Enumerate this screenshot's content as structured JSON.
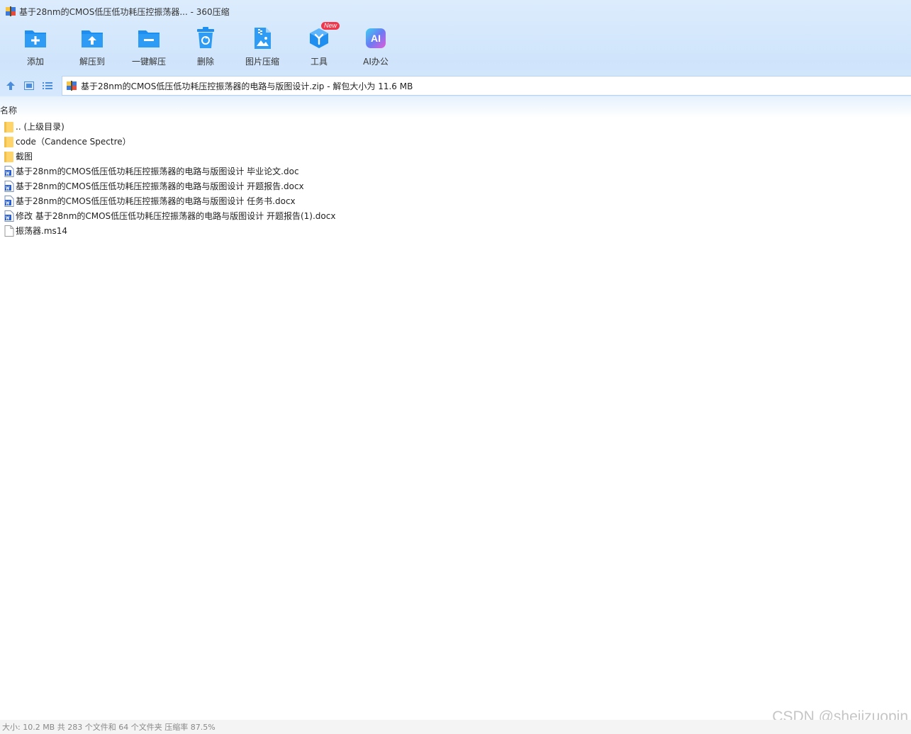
{
  "window": {
    "title": "基于28nm的CMOS低压低功耗压控振荡器... - 360压缩"
  },
  "toolbar": {
    "items": [
      {
        "label": "添加",
        "icon": "add-folder-icon"
      },
      {
        "label": "解压到",
        "icon": "extract-to-icon"
      },
      {
        "label": "一键解压",
        "icon": "one-click-extract-icon"
      },
      {
        "label": "删除",
        "icon": "trash-icon"
      },
      {
        "label": "图片压缩",
        "icon": "image-compress-icon"
      },
      {
        "label": "工具",
        "icon": "tools-icon",
        "badge": "New"
      },
      {
        "label": "AI办公",
        "icon": "ai-office-icon",
        "icon_text": "AI"
      }
    ]
  },
  "address": {
    "text": "基于28nm的CMOS低压低功耗压控振荡器的电路与版图设计.zip - 解包大小为 11.6 MB"
  },
  "list": {
    "column_name": "名称",
    "rows": [
      {
        "name": ".. (上级目录)",
        "type": "folder"
      },
      {
        "name": "code（Candence Spectre）",
        "type": "folder"
      },
      {
        "name": "截图",
        "type": "folder"
      },
      {
        "name": "基于28nm的CMOS低压低功耗压控振荡器的电路与版图设计 毕业论文.doc",
        "type": "word"
      },
      {
        "name": "基于28nm的CMOS低压低功耗压控振荡器的电路与版图设计 开题报告.docx",
        "type": "word"
      },
      {
        "name": "基于28nm的CMOS低压低功耗压控振荡器的电路与版图设计 任务书.docx",
        "type": "word"
      },
      {
        "name": "修改 基于28nm的CMOS低压低功耗压控振荡器的电路与版图设计 开题报告(1).docx",
        "type": "word"
      },
      {
        "name": "振荡器.ms14",
        "type": "file"
      }
    ]
  },
  "status": {
    "text": "大小: 10.2 MB 共 283 个文件和 64 个文件夹 压缩率 87.5%"
  },
  "watermark": "CSDN @shejizuopin",
  "colors": {
    "accent": "#1e8ff0",
    "folder": "#ffd56b",
    "word": "#2b5fce",
    "badge": "#f0364a"
  }
}
